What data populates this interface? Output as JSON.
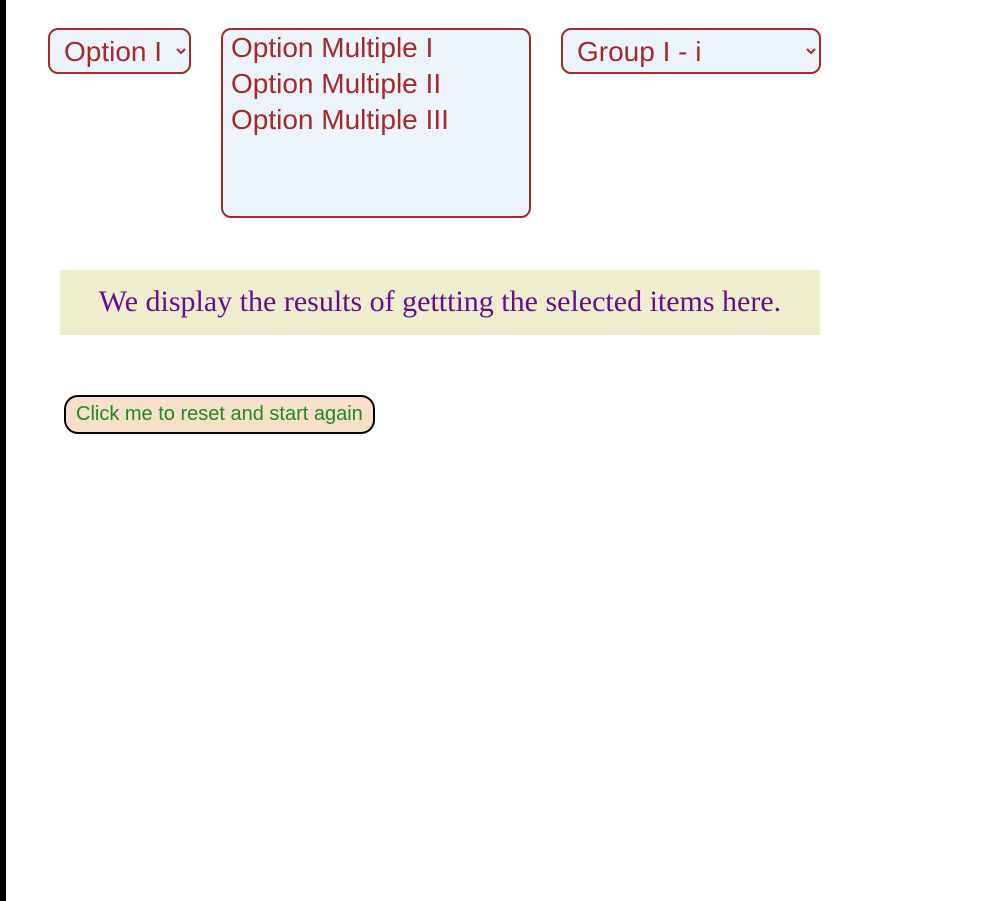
{
  "select_single": {
    "selected": "Option I",
    "options": [
      "Option I"
    ]
  },
  "select_multiple": {
    "options": [
      "Option Multiple I",
      "Option Multiple II",
      "Option Multiple III"
    ]
  },
  "select_group": {
    "selected": "Group I - i",
    "options": [
      "Group I - i"
    ]
  },
  "results_text": "We display the results of gettting the selected items here.",
  "reset_button_label": "Click me to reset and start again"
}
